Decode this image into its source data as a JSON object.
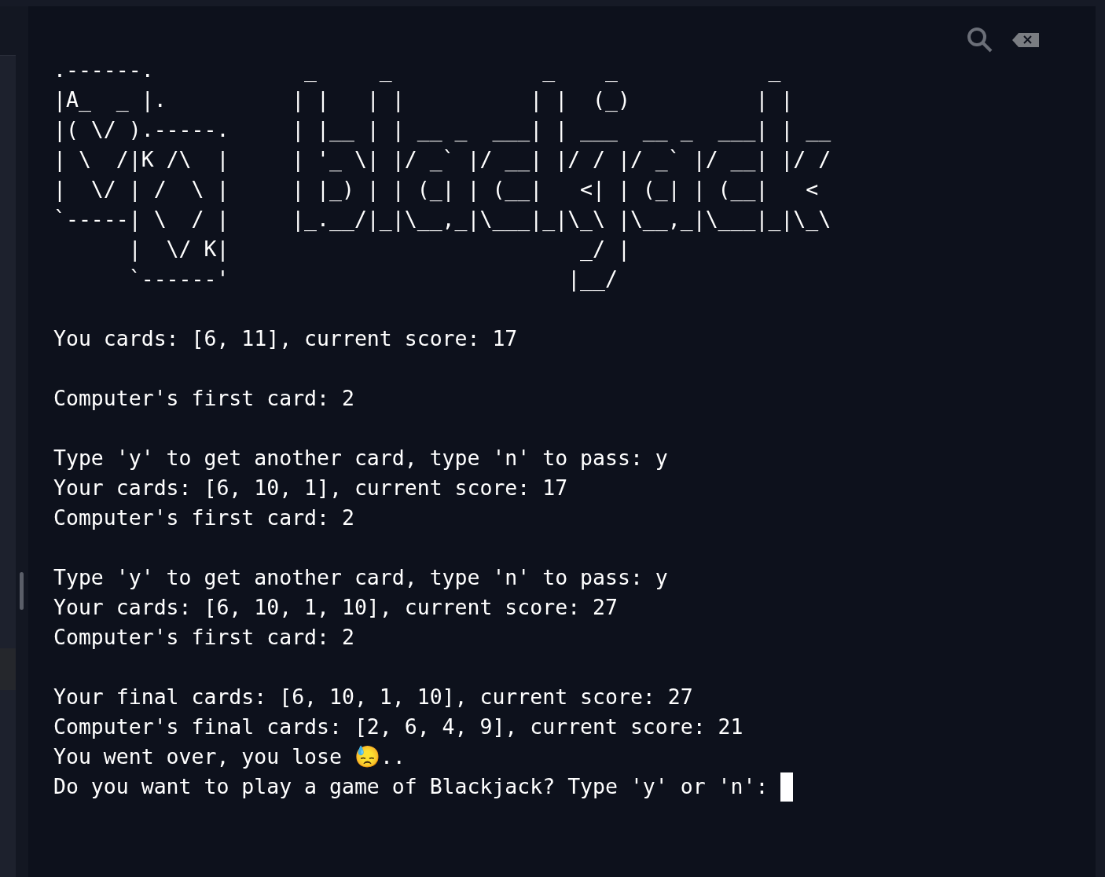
{
  "terminal": {
    "banner": [
      ".------.            _     _            _    _            _",
      "|A_  _ |.          | |   | |          | |  (_)          | |",
      "|( \\/ ).-----.     | |__ | | __ _  ___| | ___  __ _  ___| | __",
      "| \\  /|K /\\  |     | '_ \\| |/ _` |/ __| |/ / |/ _` |/ __| |/ /",
      "|  \\/ | /  \\ |     | |_) | | (_| | (__|   <| | (_| | (__|   <",
      "`-----| \\  / |     |_.__/|_|\\__,_|\\___|_|\\_\\ |\\__,_|\\___|_|\\_\\",
      "      |  \\/ K|                            _/ |",
      "      `------'                           |__/"
    ],
    "lines": [
      {
        "kind": "blank"
      },
      {
        "kind": "output",
        "text": "You cards: [6, 11], current score: 17"
      },
      {
        "kind": "blank"
      },
      {
        "kind": "output",
        "text": "Computer's first card: 2"
      },
      {
        "kind": "blank"
      },
      {
        "kind": "output",
        "text": "Type 'y' to get another card, type 'n' to pass: y"
      },
      {
        "kind": "output",
        "text": "Your cards: [6, 10, 1], current score: 17"
      },
      {
        "kind": "output",
        "text": "Computer's first card: 2"
      },
      {
        "kind": "blank"
      },
      {
        "kind": "output",
        "text": "Type 'y' to get another card, type 'n' to pass: y"
      },
      {
        "kind": "output",
        "text": "Your cards: [6, 10, 1, 10], current score: 27"
      },
      {
        "kind": "output",
        "text": "Computer's first card: 2"
      },
      {
        "kind": "blank"
      },
      {
        "kind": "output",
        "text": "Your final cards: [6, 10, 1, 10], current score: 27"
      },
      {
        "kind": "output",
        "text": "Computer's final cards: [2, 6, 4, 9], current score: 21"
      },
      {
        "kind": "output",
        "text": "You went over, you lose 😓.."
      },
      {
        "kind": "prompt",
        "text": "Do you want to play a game of Blackjack? Type 'y' or 'n': "
      }
    ]
  }
}
